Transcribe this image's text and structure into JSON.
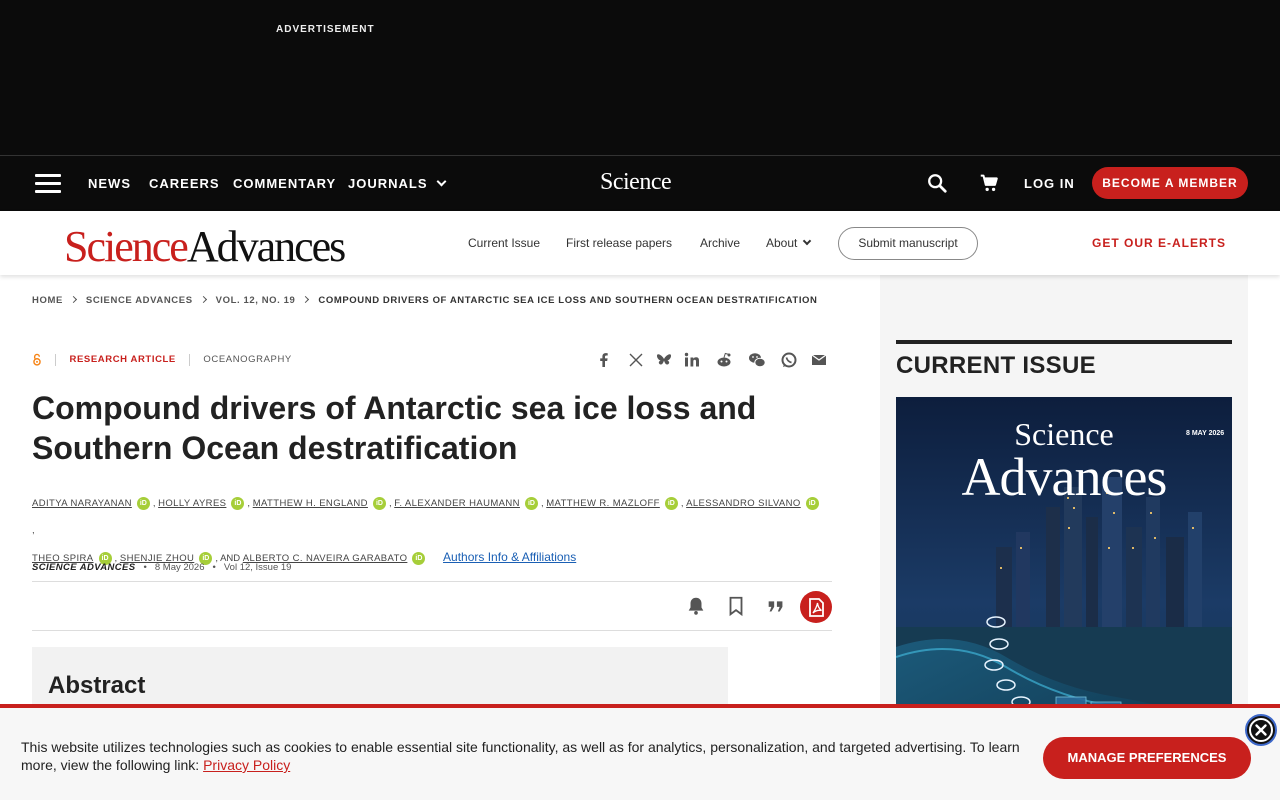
{
  "ad": {
    "label": "ADVERTISEMENT"
  },
  "topnav": {
    "items": [
      "NEWS",
      "CAREERS",
      "COMMENTARY",
      "JOURNALS"
    ],
    "logo": "Science",
    "login": "LOG IN",
    "member": "BECOME A MEMBER"
  },
  "subnav": {
    "logo_science": "Science",
    "logo_advances": "Advances",
    "items": [
      "Current Issue",
      "First release papers",
      "Archive",
      "About"
    ],
    "submit": "Submit manuscript",
    "alerts": "GET OUR E-ALERTS"
  },
  "breadcrumb": [
    "HOME",
    "SCIENCE ADVANCES",
    "VOL. 12, NO. 19",
    "COMPOUND DRIVERS OF ANTARCTIC SEA ICE LOSS AND SOUTHERN OCEAN DESTRATIFICATION"
  ],
  "article": {
    "type": "RESEARCH ARTICLE",
    "subject": "OCEANOGRAPHY",
    "title": "Compound drivers of Antarctic sea ice loss and Southern Ocean destratification",
    "authors": [
      "Aditya Narayanan",
      "Holly Ayres",
      "Matthew H. England",
      "F. Alexander Haumann",
      "Matthew R. Mazloff",
      "Alessandro Silvano",
      "Theo Spira",
      "Shenjie Zhou",
      "Alberto C. Naveira Garabato"
    ],
    "and": "AND",
    "orcid": "iD",
    "affiliations": "Authors Info & Affiliations",
    "journal": "SCIENCE ADVANCES",
    "date": "8 May 2026",
    "volume": "Vol 12, Issue 19",
    "abstract_heading": "Abstract"
  },
  "sidebar": {
    "heading": "CURRENT ISSUE",
    "cover_title_1": "Science",
    "cover_title_2": "Advances",
    "cover_date": "8 MAY 2026"
  },
  "cookie": {
    "text": "This website utilizes technologies such as cookies to enable essential site functionality, as well as for analytics, personalization, and targeted advertising. To learn more, view the following link: ",
    "link": "Privacy Policy",
    "button": "MANAGE PREFERENCES"
  },
  "colors": {
    "brand_red": "#c8201d",
    "orcid_green": "#a6ce39",
    "dark": "#0b0b0b"
  }
}
